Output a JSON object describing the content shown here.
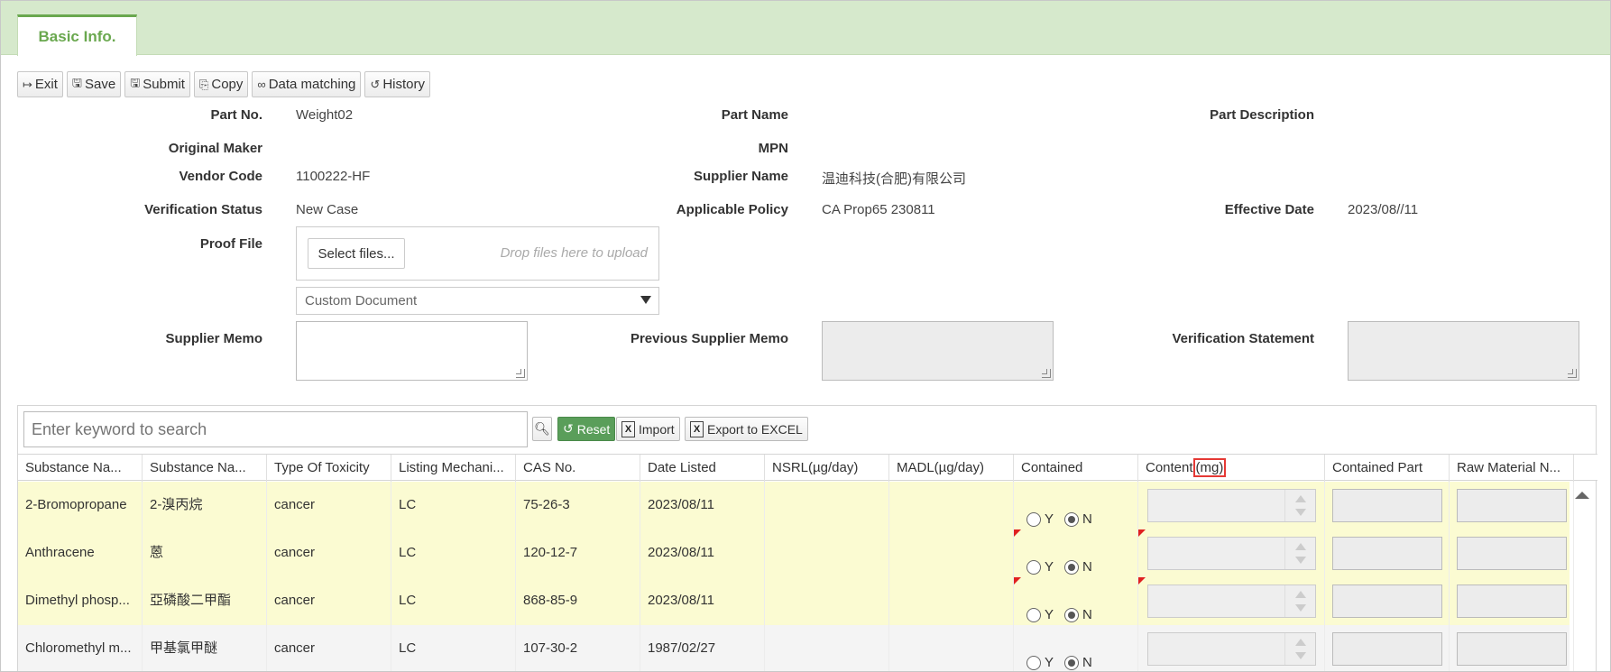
{
  "tabs": [
    {
      "label": "Basic Info."
    }
  ],
  "toolbar": {
    "exit": "Exit",
    "save": "Save",
    "submit": "Submit",
    "copy": "Copy",
    "data_matching": "Data matching",
    "history": "History"
  },
  "form": {
    "part_no_label": "Part No.",
    "part_no": "Weight02",
    "part_name_label": "Part Name",
    "part_name": "",
    "part_desc_label": "Part Description",
    "part_desc": "",
    "original_maker_label": "Original Maker",
    "original_maker": "",
    "mpn_label": "MPN",
    "mpn": "",
    "vendor_code_label": "Vendor Code",
    "vendor_code": "1100222-HF",
    "supplier_name_label": "Supplier Name",
    "supplier_name": "温迪科技(合肥)有限公司",
    "verification_status_label": "Verification Status",
    "verification_status": "New Case",
    "applicable_policy_label": "Applicable Policy",
    "applicable_policy": "CA Prop65 230811",
    "effective_date_label": "Effective Date",
    "effective_date": "2023/08//11",
    "proof_file_label": "Proof File",
    "select_files": "Select files...",
    "drop_hint": "Drop files here to upload",
    "document_type": "Custom Document",
    "supplier_memo_label": "Supplier Memo",
    "prev_supplier_memo_label": "Previous Supplier Memo",
    "verification_statement_label": "Verification Statement"
  },
  "grid": {
    "search_placeholder": "Enter keyword to search",
    "reset": "Reset",
    "import": "Import",
    "export": "Export to EXCEL",
    "columns": {
      "c1": "Substance Na...",
      "c2": "Substance Na...",
      "c3": "Type Of Toxicity",
      "c4": "Listing Mechani...",
      "c5": "CAS No.",
      "c6": "Date Listed",
      "c7": "NSRL(µg/day)",
      "c8": "MADL(µg/day)",
      "c9": "Contained",
      "c10_prefix": "Content",
      "c10_unit": "(mg)",
      "c11": "Contained Part",
      "c12": "Raw Material N..."
    },
    "radio_y": "Y",
    "radio_n": "N",
    "rows": [
      {
        "name_en": "2-Bromopropane",
        "name_zh": "2-溴丙烷",
        "toxicity": "cancer",
        "mechanism": "LC",
        "cas": "75-26-3",
        "date": "2023/08/11",
        "nsrl": "",
        "madl": "",
        "contained": "N"
      },
      {
        "name_en": "Anthracene",
        "name_zh": "蒽",
        "toxicity": "cancer",
        "mechanism": "LC",
        "cas": "120-12-7",
        "date": "2023/08/11",
        "nsrl": "",
        "madl": "",
        "contained": "N"
      },
      {
        "name_en": "Dimethyl phosp...",
        "name_zh": "亞磷酸二甲酯",
        "toxicity": "cancer",
        "mechanism": "LC",
        "cas": "868-85-9",
        "date": "2023/08/11",
        "nsrl": "",
        "madl": "",
        "contained": "N"
      },
      {
        "name_en": "Chloromethyl m...",
        "name_zh": "甲基氯甲醚",
        "toxicity": "cancer",
        "mechanism": "LC",
        "cas": "107-30-2",
        "date": "1987/02/27",
        "nsrl": "",
        "madl": "",
        "contained": "N"
      }
    ]
  },
  "colors": {
    "accent": "#6aa84f",
    "tabbar": "#d6e9cc",
    "highlight_row": "#fbfbd2",
    "flag": "#e02020"
  }
}
